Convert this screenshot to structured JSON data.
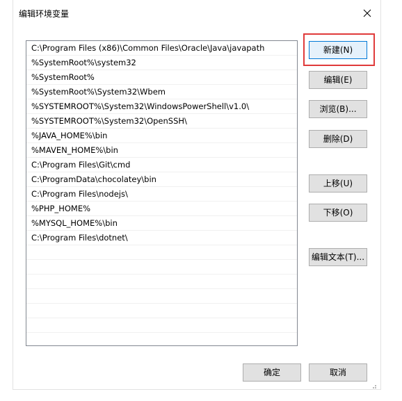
{
  "window": {
    "title": "编辑环境变量"
  },
  "icons": {
    "close": "close-icon",
    "grip": "resize-grip-icon"
  },
  "paths": [
    "C:\\Program Files (x86)\\Common Files\\Oracle\\Java\\javapath",
    "%SystemRoot%\\system32",
    "%SystemRoot%",
    "%SystemRoot%\\System32\\Wbem",
    "%SYSTEMROOT%\\System32\\WindowsPowerShell\\v1.0\\",
    "%SYSTEMROOT%\\System32\\OpenSSH\\",
    "%JAVA_HOME%\\bin",
    "%MAVEN_HOME%\\bin",
    "C:\\Program Files\\Git\\cmd",
    "C:\\ProgramData\\chocolatey\\bin",
    "C:\\Program Files\\nodejs\\",
    "%PHP_HOME%",
    "%MYSQL_HOME%\\bin",
    "C:\\Program Files\\dotnet\\"
  ],
  "buttons": {
    "new": "新建(N)",
    "edit": "编辑(E)",
    "browse": "浏览(B)...",
    "delete": "删除(D)",
    "move_up": "上移(U)",
    "move_down": "下移(O)",
    "edit_text": "编辑文本(T)...",
    "ok": "确定",
    "cancel": "取消"
  },
  "colors": {
    "highlight": "#e03a3a",
    "focus_border": "#0078d7"
  }
}
